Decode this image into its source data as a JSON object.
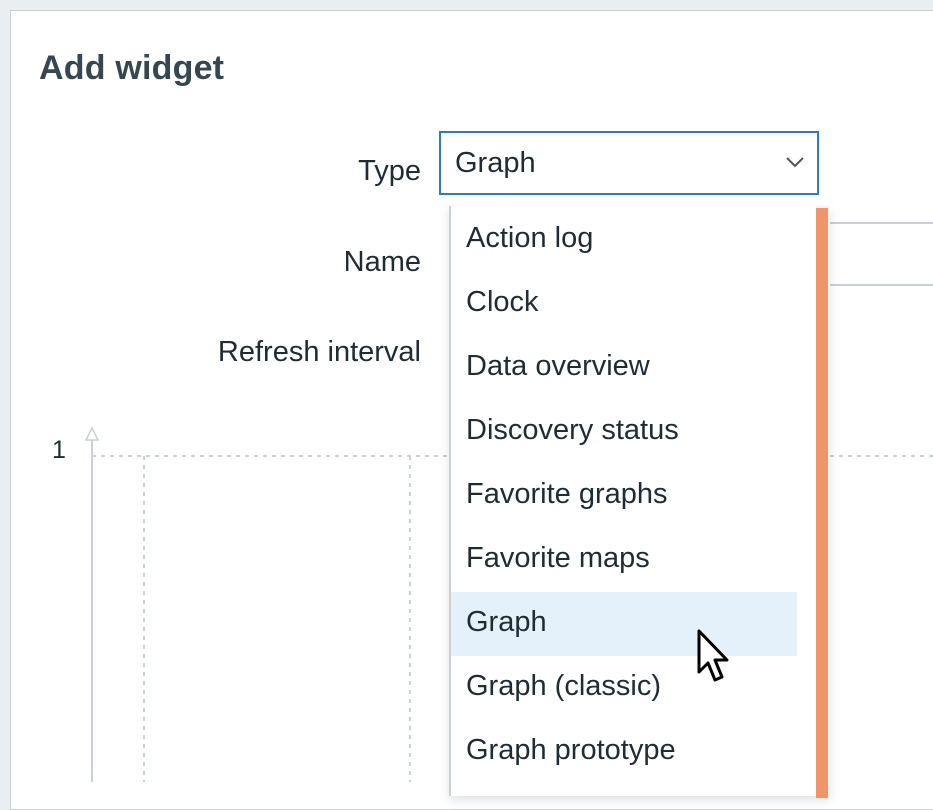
{
  "dialog": {
    "title": "Add widget"
  },
  "form": {
    "type_label": "Type",
    "name_label": "Name",
    "refresh_label": "Refresh interval",
    "type_select": {
      "value": "Graph",
      "icon": "chevron-down-icon"
    },
    "type_options": [
      {
        "label": "Action log",
        "selected": false
      },
      {
        "label": "Clock",
        "selected": false
      },
      {
        "label": "Data overview",
        "selected": false
      },
      {
        "label": "Discovery status",
        "selected": false
      },
      {
        "label": "Favorite graphs",
        "selected": false
      },
      {
        "label": "Favorite maps",
        "selected": false
      },
      {
        "label": "Graph",
        "selected": true
      },
      {
        "label": "Graph (classic)",
        "selected": false
      },
      {
        "label": "Graph prototype",
        "selected": false
      }
    ]
  },
  "preview": {
    "y_tick": "1"
  },
  "colors": {
    "accent_border": "#2f7db5",
    "scrollbar": "#f0956a",
    "selected_bg": "#e4f1fb",
    "title": "#37474f"
  }
}
